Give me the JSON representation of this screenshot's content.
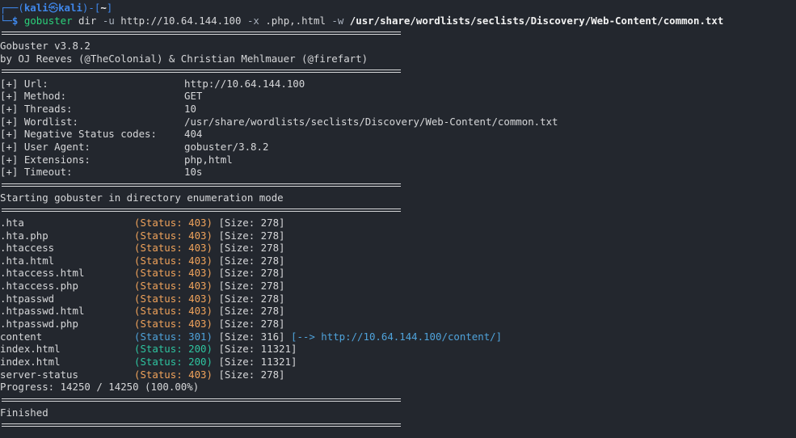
{
  "prompt": {
    "corner_top": "┌──(",
    "user": "kali",
    "at": "㉿",
    "host": "kali",
    "mid": ")-[",
    "path": "~",
    "end": "]",
    "corner_bottom": "└─",
    "dollar": "$"
  },
  "command": {
    "tool": "gobuster",
    "mode": "dir",
    "flag_u": "-u",
    "url": "http://10.64.144.100",
    "flag_x": "-x",
    "extensions": ".php,.html",
    "flag_w": "-w",
    "wordlist": "/usr/share/wordlists/seclists/Discovery/Web-Content/common.txt"
  },
  "banner": {
    "version_line": "Gobuster v3.8.2",
    "authors_line": "by OJ Reeves (@TheColonial) & Christian Mehlmauer (@firefart)"
  },
  "config": [
    {
      "key": "[+] Url:",
      "value": "http://10.64.144.100"
    },
    {
      "key": "[+] Method:",
      "value": "GET"
    },
    {
      "key": "[+] Threads:",
      "value": "10"
    },
    {
      "key": "[+] Wordlist:",
      "value": "/usr/share/wordlists/seclists/Discovery/Web-Content/common.txt"
    },
    {
      "key": "[+] Negative Status codes:",
      "value": "404"
    },
    {
      "key": "[+] User Agent:",
      "value": "gobuster/3.8.2"
    },
    {
      "key": "[+] Extensions:",
      "value": "php,html"
    },
    {
      "key": "[+] Timeout:",
      "value": "10s"
    }
  ],
  "start_message": "Starting gobuster in directory enumeration mode",
  "results": [
    {
      "name": ".hta",
      "status": "(Status: 403)",
      "code": "403",
      "size": "[Size: 278]",
      "redirect": ""
    },
    {
      "name": ".hta.php",
      "status": "(Status: 403)",
      "code": "403",
      "size": "[Size: 278]",
      "redirect": ""
    },
    {
      "name": ".htaccess",
      "status": "(Status: 403)",
      "code": "403",
      "size": "[Size: 278]",
      "redirect": ""
    },
    {
      "name": ".hta.html",
      "status": "(Status: 403)",
      "code": "403",
      "size": "[Size: 278]",
      "redirect": ""
    },
    {
      "name": ".htaccess.html",
      "status": "(Status: 403)",
      "code": "403",
      "size": "[Size: 278]",
      "redirect": ""
    },
    {
      "name": ".htaccess.php",
      "status": "(Status: 403)",
      "code": "403",
      "size": "[Size: 278]",
      "redirect": ""
    },
    {
      "name": ".htpasswd",
      "status": "(Status: 403)",
      "code": "403",
      "size": "[Size: 278]",
      "redirect": ""
    },
    {
      "name": ".htpasswd.html",
      "status": "(Status: 403)",
      "code": "403",
      "size": "[Size: 278]",
      "redirect": ""
    },
    {
      "name": ".htpasswd.php",
      "status": "(Status: 403)",
      "code": "403",
      "size": "[Size: 278]",
      "redirect": ""
    },
    {
      "name": "content",
      "status": "(Status: 301)",
      "code": "301",
      "size": "[Size: 316]",
      "redirect": "[--> http://10.64.144.100/content/]"
    },
    {
      "name": "index.html",
      "status": "(Status: 200)",
      "code": "200",
      "size": "[Size: 11321]",
      "redirect": ""
    },
    {
      "name": "index.html",
      "status": "(Status: 200)",
      "code": "200",
      "size": "[Size: 11321]",
      "redirect": ""
    },
    {
      "name": "server-status",
      "status": "(Status: 403)",
      "code": "403",
      "size": "[Size: 278]",
      "redirect": ""
    }
  ],
  "progress": "Progress: 14250 / 14250 (100.00%)",
  "finished": "Finished",
  "colors": {
    "background": "#23272e",
    "prompt": "#3f87ea",
    "command": "#2bd17a",
    "status_403": "#f0a35b",
    "status_301": "#4fa3db",
    "status_200": "#2ec4a0"
  }
}
